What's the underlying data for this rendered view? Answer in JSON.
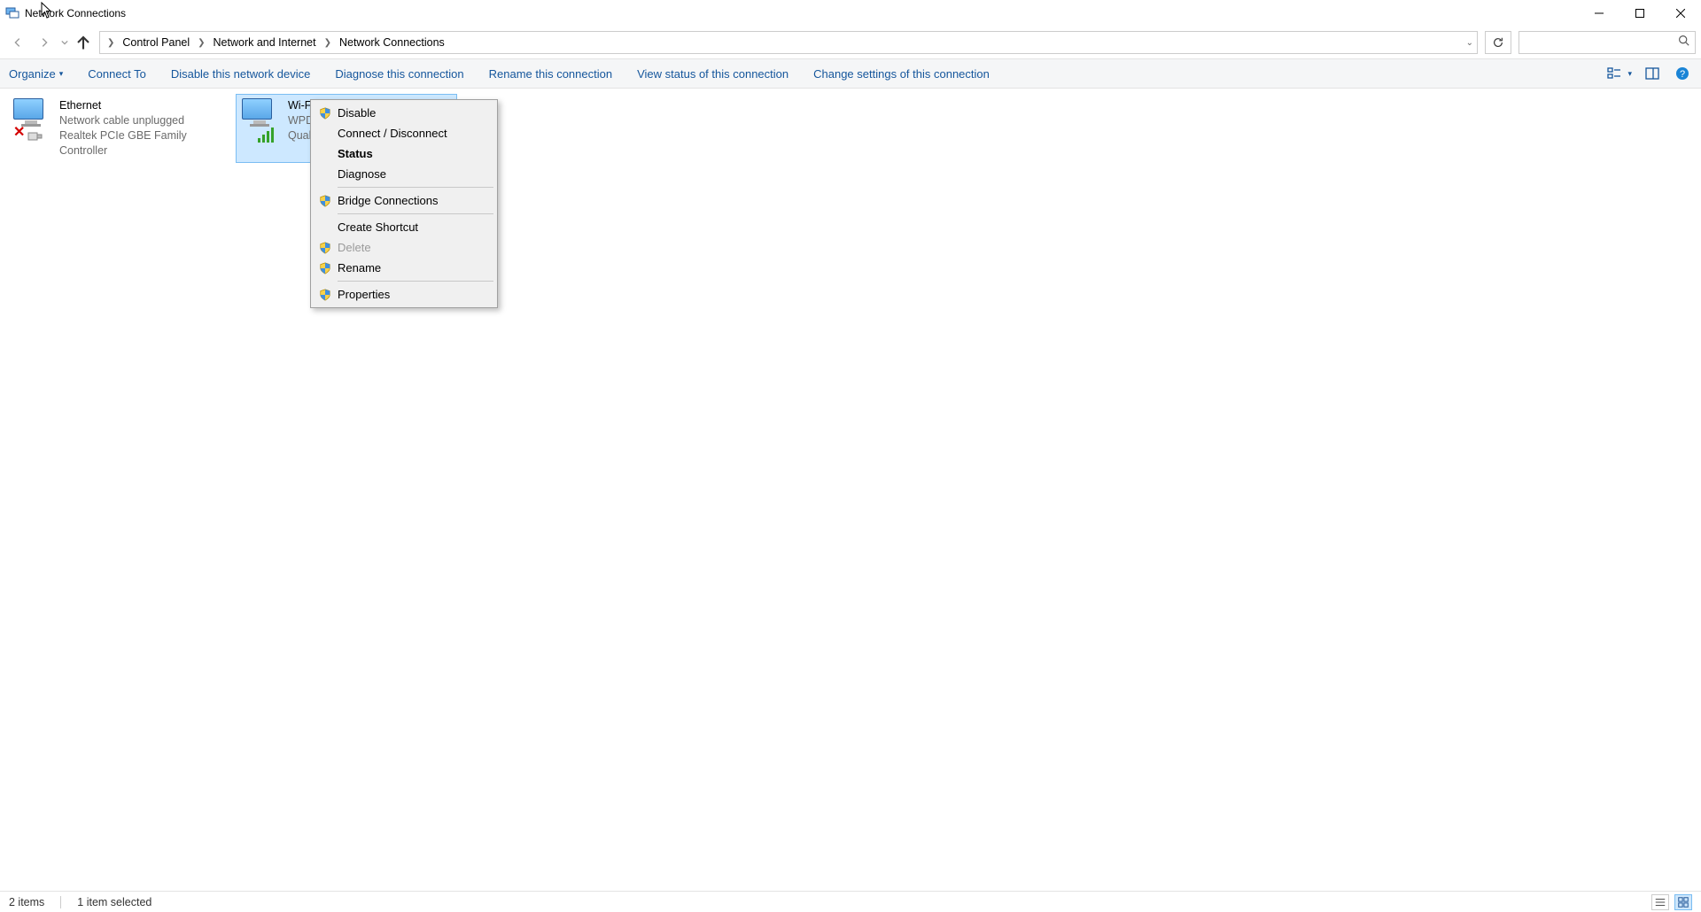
{
  "window": {
    "title": "Network Connections"
  },
  "breadcrumb": {
    "items": [
      "Control Panel",
      "Network and Internet",
      "Network Connections"
    ]
  },
  "toolbar": {
    "organize": "Organize",
    "connect_to": "Connect To",
    "disable": "Disable this network device",
    "diagnose": "Diagnose this connection",
    "rename": "Rename this connection",
    "view_status": "View status of this connection",
    "change_settings": "Change settings of this connection"
  },
  "adapters": [
    {
      "name": "Ethernet",
      "status": "Network cable unplugged",
      "device": "Realtek PCIe GBE Family Controller",
      "selected": false,
      "type": "wired",
      "error": true
    },
    {
      "name": "Wi-Fi",
      "status": "WPD…",
      "device": "Qualc…",
      "selected": true,
      "type": "wifi",
      "error": false
    }
  ],
  "context_menu": {
    "items": [
      {
        "label": "Disable",
        "shield": true
      },
      {
        "label": "Connect / Disconnect"
      },
      {
        "label": "Status",
        "bold": true
      },
      {
        "label": "Diagnose"
      },
      {
        "sep": true
      },
      {
        "label": "Bridge Connections",
        "shield": true
      },
      {
        "sep": true
      },
      {
        "label": "Create Shortcut"
      },
      {
        "label": "Delete",
        "shield": true,
        "disabled": true
      },
      {
        "label": "Rename",
        "shield": true
      },
      {
        "sep": true
      },
      {
        "label": "Properties",
        "shield": true
      }
    ]
  },
  "statusbar": {
    "items_count": "2 items",
    "selection": "1 item selected"
  },
  "search": {
    "placeholder": ""
  }
}
